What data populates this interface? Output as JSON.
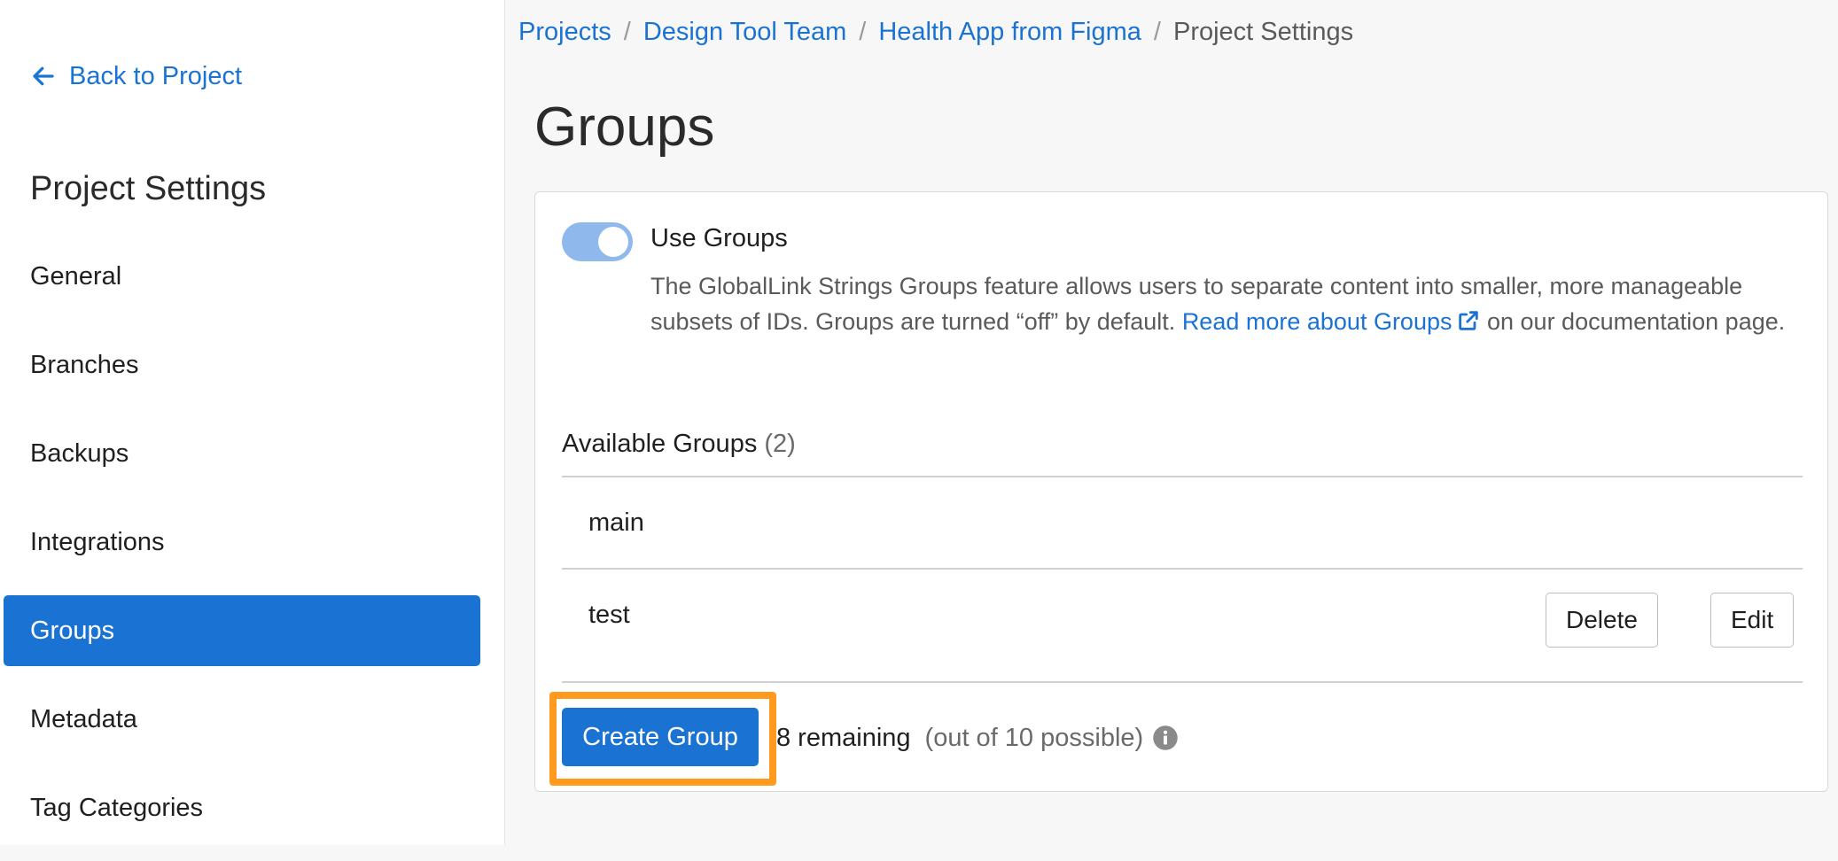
{
  "sidebar": {
    "back_label": "Back to Project",
    "title": "Project Settings",
    "items": [
      {
        "label": "General",
        "active": false
      },
      {
        "label": "Branches",
        "active": false
      },
      {
        "label": "Backups",
        "active": false
      },
      {
        "label": "Integrations",
        "active": false
      },
      {
        "label": "Groups",
        "active": true
      },
      {
        "label": "Metadata",
        "active": false
      },
      {
        "label": "Tag Categories",
        "active": false
      }
    ]
  },
  "breadcrumb": {
    "items": [
      "Projects",
      "Design Tool Team",
      "Health App from Figma"
    ],
    "current": "Project Settings",
    "separator": "/"
  },
  "page": {
    "title": "Groups"
  },
  "groups_card": {
    "toggle_label": "Use Groups",
    "toggle_on": true,
    "description_before": "The GlobalLink Strings Groups feature allows users to separate content into smaller, more manageable subsets of IDs. Groups are turned “off” by default. ",
    "doc_link": "Read more about Groups",
    "description_after": " on our documentation page.",
    "available_label": "Available Groups",
    "available_count": "(2)",
    "groups": [
      {
        "name": "main"
      },
      {
        "name": "test",
        "delete_label": "Delete",
        "edit_label": "Edit"
      }
    ],
    "create_label": "Create Group",
    "remaining": "8 remaining",
    "possible": "(out of 10 possible)"
  },
  "colors": {
    "accent": "#1a73d2",
    "highlight": "#ff9a1f",
    "toggle_track": "#8fb8ec"
  }
}
